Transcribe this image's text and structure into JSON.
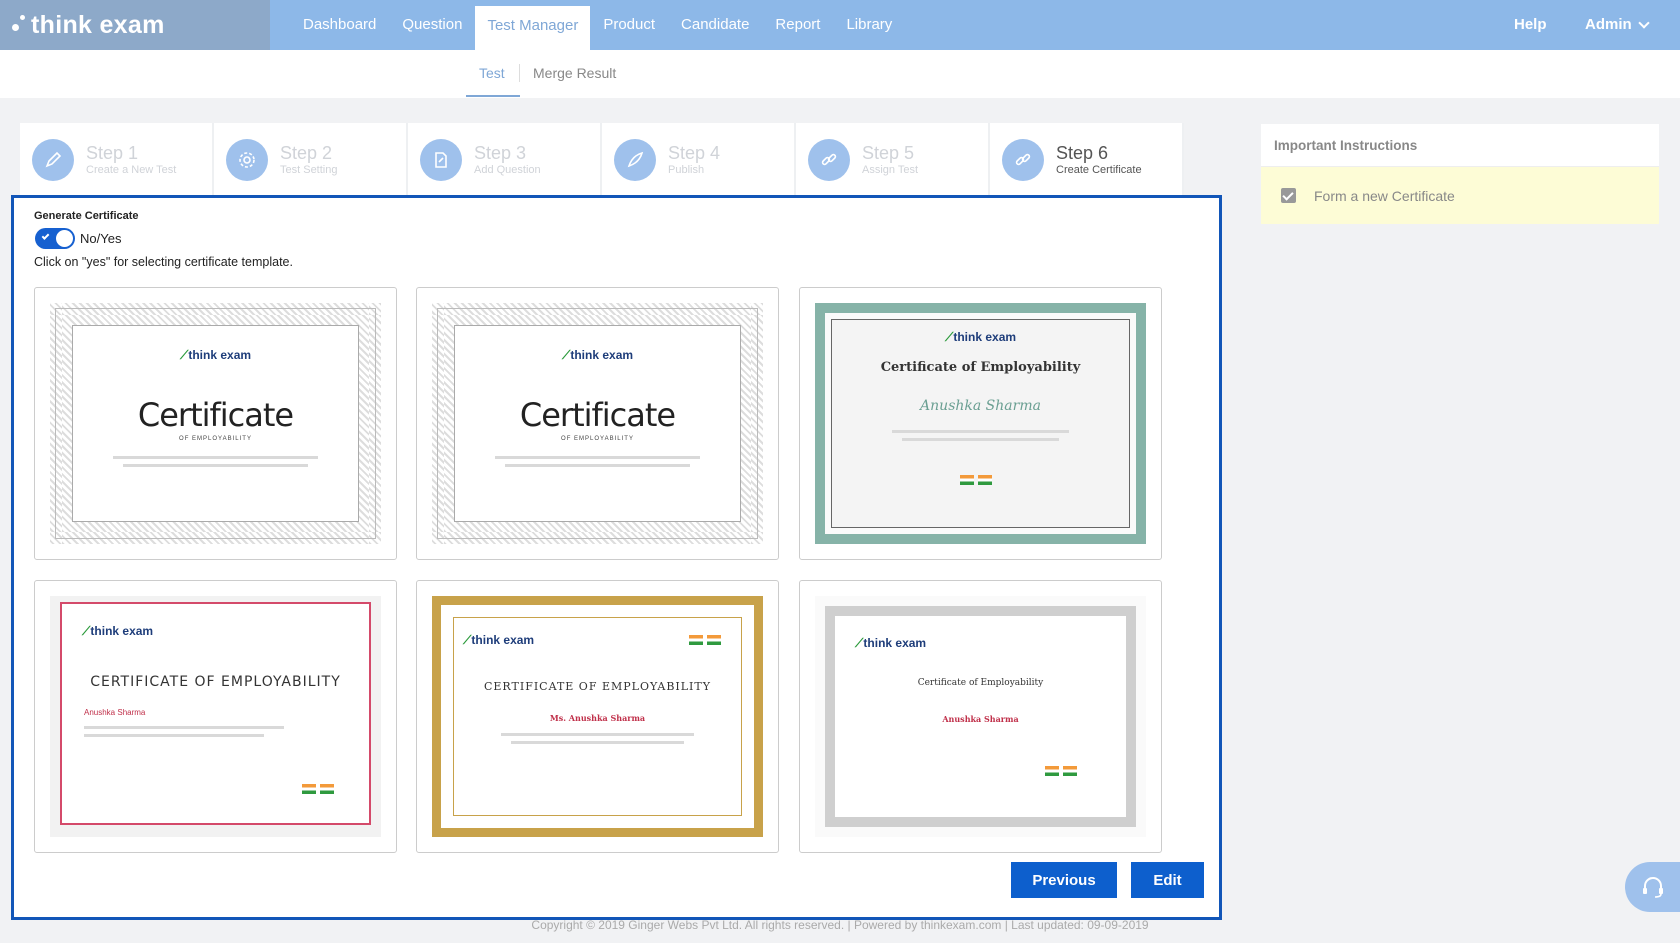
{
  "app": {
    "logo_text": "think exam"
  },
  "nav": {
    "items": [
      {
        "label": "Dashboard",
        "active": false
      },
      {
        "label": "Question",
        "active": false
      },
      {
        "label": "Test Manager",
        "active": true
      },
      {
        "label": "Product",
        "active": false
      },
      {
        "label": "Candidate",
        "active": false
      },
      {
        "label": "Report",
        "active": false
      },
      {
        "label": "Library",
        "active": false
      }
    ],
    "help": "Help",
    "admin": "Admin"
  },
  "subnav": {
    "tabs": [
      {
        "label": "Test",
        "active": true
      },
      {
        "label": "Merge Result",
        "active": false
      }
    ]
  },
  "steps": [
    {
      "title": "Step 1",
      "subtitle": "Create a New Test",
      "icon": "pencil-icon",
      "active": false
    },
    {
      "title": "Step 2",
      "subtitle": "Test Setting",
      "icon": "gear-icon",
      "active": false
    },
    {
      "title": "Step 3",
      "subtitle": "Add Question",
      "icon": "document-edit-icon",
      "active": false
    },
    {
      "title": "Step 4",
      "subtitle": "Publish",
      "icon": "rocket-icon",
      "active": false
    },
    {
      "title": "Step 5",
      "subtitle": "Assign Test",
      "icon": "link-icon",
      "active": false
    },
    {
      "title": "Step 6",
      "subtitle": "Create Certificate",
      "icon": "link-icon",
      "active": true
    }
  ],
  "certificate_panel": {
    "label": "Generate Certificate",
    "toggle_label": "No/Yes",
    "toggle_on": true,
    "hint": "Click on \"yes\" for selecting certificate template."
  },
  "templates": [
    {
      "style": "ornate",
      "brand": "think exam",
      "title": "Certificate",
      "subtitle": "OF EMPLOYABILITY"
    },
    {
      "style": "ornate",
      "brand": "think exam",
      "title": "Certificate",
      "subtitle": "OF EMPLOYABILITY"
    },
    {
      "style": "teal",
      "brand": "think exam",
      "title": "Certificate of Employability",
      "name": "Anushka Sharma"
    },
    {
      "style": "red",
      "brand": "think exam",
      "title": "CERTIFICATE OF EMPLOYABILITY",
      "name": "Anushka Sharma"
    },
    {
      "style": "gold",
      "brand": "think exam",
      "title": "CERTIFICATE OF EMPLOYABILITY",
      "name": "Ms. Anushka Sharma"
    },
    {
      "style": "grey",
      "brand": "think exam",
      "title": "Certificate of Employability",
      "name": "Anushka Sharma"
    }
  ],
  "buttons": {
    "previous": "Previous",
    "edit": "Edit"
  },
  "instructions": {
    "title": "Important Instructions",
    "items": [
      {
        "label": "Form a new Certificate",
        "checked": true
      }
    ]
  },
  "footer": {
    "text": "Copyright © 2019 Ginger Webs Pvt Ltd. All rights reserved.  |  Powered by thinkexam.com  |  Last updated: 09-09-2019"
  }
}
